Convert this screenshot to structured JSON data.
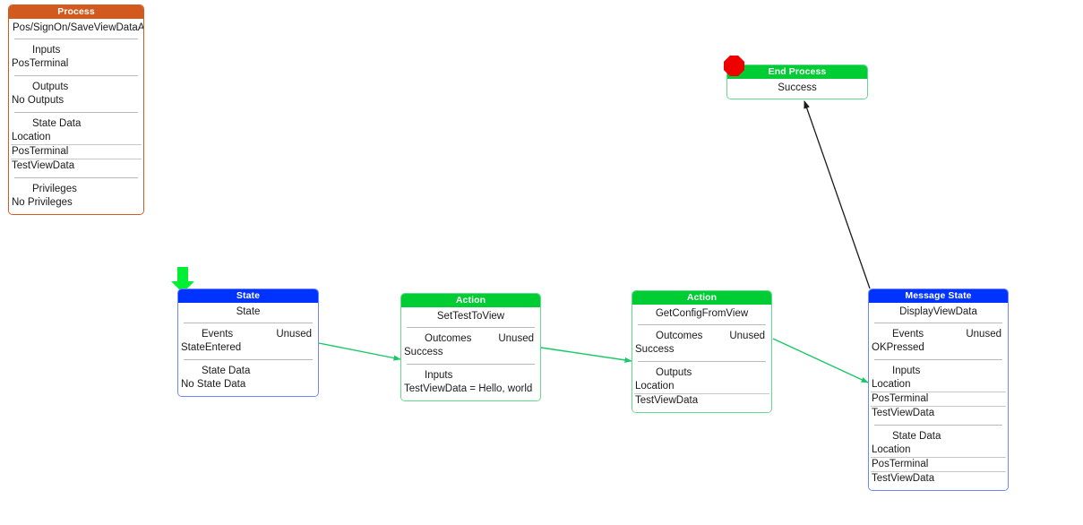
{
  "colors": {
    "process_header": "#d35a1e",
    "state_header": "#0033ff",
    "action_header": "#00cc33",
    "end_header": "#00cc33",
    "edge_green": "#16c964",
    "edge_black": "#1a1a1a",
    "stop_icon": "#ee0000",
    "entry_arrow": "#00ee33"
  },
  "nodes": {
    "process": {
      "header": "Process",
      "title": "Pos/SignOn/SaveViewDataAt...",
      "sections": [
        {
          "label": "Inputs",
          "unused": "",
          "rows": [
            "PosTerminal"
          ],
          "row_seps": false
        },
        {
          "label": "Outputs",
          "unused": "",
          "rows": [
            "No Outputs"
          ],
          "row_seps": false
        },
        {
          "label": "State Data",
          "unused": "",
          "rows": [
            "Location",
            "PosTerminal",
            "TestViewData"
          ],
          "row_seps": true
        },
        {
          "label": "Privileges",
          "unused": "",
          "rows": [
            "No Privileges"
          ],
          "row_seps": false
        }
      ]
    },
    "state": {
      "header": "State",
      "title": "State",
      "sections": [
        {
          "label": "Events",
          "unused": "Unused",
          "rows": [
            "StateEntered"
          ],
          "row_seps": false
        },
        {
          "label": "State Data",
          "unused": "",
          "rows": [
            "No State Data"
          ],
          "row_seps": false
        }
      ]
    },
    "action1": {
      "header": "Action",
      "title": "SetTestToView",
      "sections": [
        {
          "label": "Outcomes",
          "unused": "Unused",
          "rows": [
            "Success"
          ],
          "row_seps": false
        },
        {
          "label": "Inputs",
          "unused": "",
          "rows": [
            "TestViewData = Hello, world"
          ],
          "row_seps": false
        }
      ]
    },
    "action2": {
      "header": "Action",
      "title": "GetConfigFromView",
      "sections": [
        {
          "label": "Outcomes",
          "unused": "Unused",
          "rows": [
            "Success"
          ],
          "row_seps": false
        },
        {
          "label": "Outputs",
          "unused": "",
          "rows": [
            "Location",
            "TestViewData"
          ],
          "row_seps": true
        }
      ]
    },
    "messagestate": {
      "header": "Message State",
      "title": "DisplayViewData",
      "sections": [
        {
          "label": "Events",
          "unused": "Unused",
          "rows": [
            "OKPressed"
          ],
          "row_seps": false
        },
        {
          "label": "Inputs",
          "unused": "",
          "rows": [
            "Location",
            "PosTerminal",
            "TestViewData"
          ],
          "row_seps": true
        },
        {
          "label": "State Data",
          "unused": "",
          "rows": [
            "Location",
            "PosTerminal",
            "TestViewData"
          ],
          "row_seps": true
        }
      ]
    },
    "endprocess": {
      "header": "End Process",
      "title": "Success",
      "sections": []
    }
  }
}
